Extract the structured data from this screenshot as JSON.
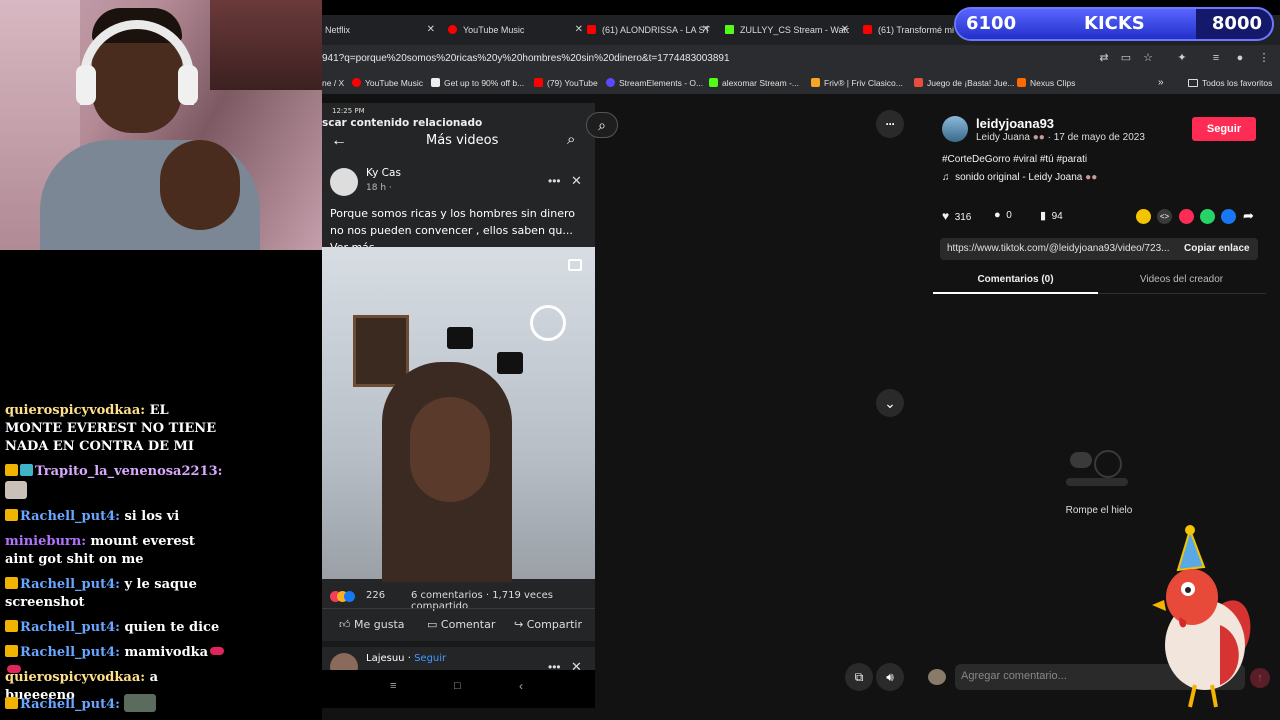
{
  "overlay": {
    "kicks_current": "6100",
    "kicks_label": "KICKS",
    "kicks_goal": "8000",
    "kicks_progress": 0.76
  },
  "chat": {
    "messages": [
      {
        "user": "quierospicyvodkaa:",
        "text": "EL MONTE EVEREST NO TIENE NADA EN CONTRA DE MI"
      },
      {
        "user": "Trapito_la_venenosa2213:",
        "text": ""
      },
      {
        "user": "Rachell_put4:",
        "text": "si los vi"
      },
      {
        "user": "minieburn:",
        "text": "mount everest aint got shit on me"
      },
      {
        "user": "Rachell_put4:",
        "text": "y le saque screenshot"
      },
      {
        "user": "Rachell_put4:",
        "text": "quien te dice"
      },
      {
        "user": "Rachell_put4:",
        "text": "mamivodka"
      },
      {
        "user": "quierospicyvodkaa:",
        "text": "a bueeeeno"
      },
      {
        "user": "Rachell_put4:",
        "text": ""
      }
    ]
  },
  "browser": {
    "tabs": [
      {
        "label": "Netflix",
        "color": "#e50914"
      },
      {
        "label": "YouTube Music",
        "color": "#ff0000"
      },
      {
        "label": "(61) ALONDRISSA - LA STI",
        "color": "#ff0000"
      },
      {
        "label": "ZULLYY_CS Stream - Watc",
        "color": "#53fc18"
      },
      {
        "label": "(61) Transformé mi hab",
        "color": "#ff0000"
      }
    ],
    "url": "941?q=porque%20somos%20ricas%20y%20hombres%20sin%20dinero&t=1774483003891",
    "bookmarks": [
      {
        "label": "ne / X",
        "color": "#333333"
      },
      {
        "label": "YouTube Music",
        "color": "#ff0000"
      },
      {
        "label": "Get up to 90% off b...",
        "color": "#111111"
      },
      {
        "label": "(79) YouTube",
        "color": "#ff0000"
      },
      {
        "label": "StreamElements - O...",
        "color": "#5a4bff"
      },
      {
        "label": "alexomar Stream -...",
        "color": "#53fc18"
      },
      {
        "label": "Friv® | Friv Clasico...",
        "color": "#f6a623"
      },
      {
        "label": "Juego de ¡Basta! Jue...",
        "color": "#e74c3c"
      },
      {
        "label": "Nexus Clips",
        "color": "#ff6a00"
      }
    ],
    "all_favorites": "Todos los favoritos"
  },
  "phone": {
    "time": "12:25 PM",
    "search_hint": "scar contenido relacionado",
    "header": "Más videos",
    "post": {
      "author": "Ky Cas",
      "time": "18 h ·",
      "text": "Porque somos ricas y los hombres sin dinero no nos pueden convencer , ellos saben qu... Ver más",
      "reactions": "226",
      "stats": "6 comentarios · 1,719 veces compartido",
      "like": "Me gusta",
      "comment": "Comentar",
      "share": "Compartir"
    },
    "next_post": {
      "author": "Lajesuu ·",
      "follow": "Seguir"
    }
  },
  "tiktok": {
    "username": "leidyjoana93",
    "display_name": "Leidy Juana",
    "date": "· 17 de mayo de 2023",
    "follow": "Seguir",
    "hashtags": "#CorteDeGorro #viral #tú #parati",
    "sound": "sonido original - Leidy Joana",
    "likes": "316",
    "comments": "0",
    "saves": "94",
    "link": "https://www.tiktok.com/@leidyjoana93/video/723...",
    "copy_link": "Copiar enlace",
    "tab_comments": "Comentarios (0)",
    "tab_creator": "Videos del creador",
    "empty_state": "Rompe el hielo",
    "comment_placeholder": "Agregar comentario...",
    "more_icon": "···"
  }
}
